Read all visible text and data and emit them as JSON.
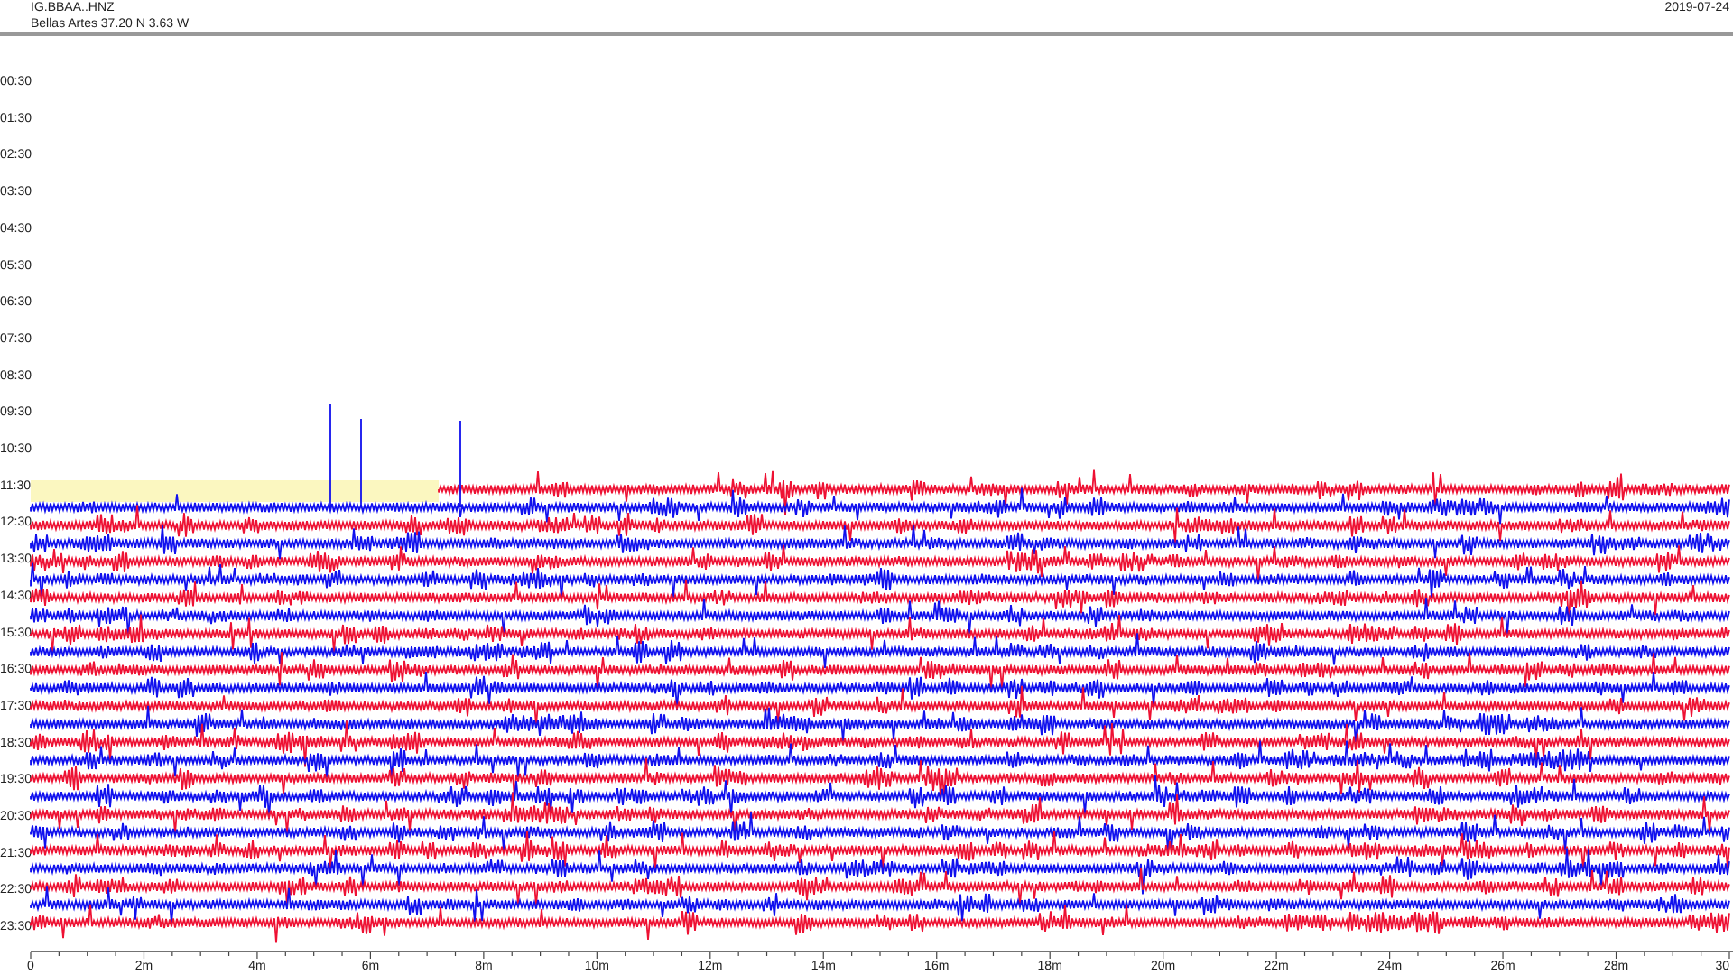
{
  "header": {
    "channel": "IG.BBAA..HNZ",
    "station": "Bellas Artes  37.20 N 3.63 W",
    "date": "2019-07-24"
  },
  "time_labels": [
    "00:30",
    "01:30",
    "02:30",
    "03:30",
    "04:30",
    "05:30",
    "06:30",
    "07:30",
    "08:30",
    "09:30",
    "10:30",
    "11:30",
    "12:30",
    "13:30",
    "14:30",
    "15:30",
    "16:30",
    "17:30",
    "18:30",
    "19:30",
    "20:30",
    "21:30",
    "22:30",
    "23:30"
  ],
  "x_axis_labels": [
    "0",
    "2m",
    "4m",
    "6m",
    "8m",
    "10m",
    "12m",
    "14m",
    "16m",
    "18m",
    "20m",
    "22m",
    "24m",
    "26m",
    "28m",
    "30"
  ]
}
